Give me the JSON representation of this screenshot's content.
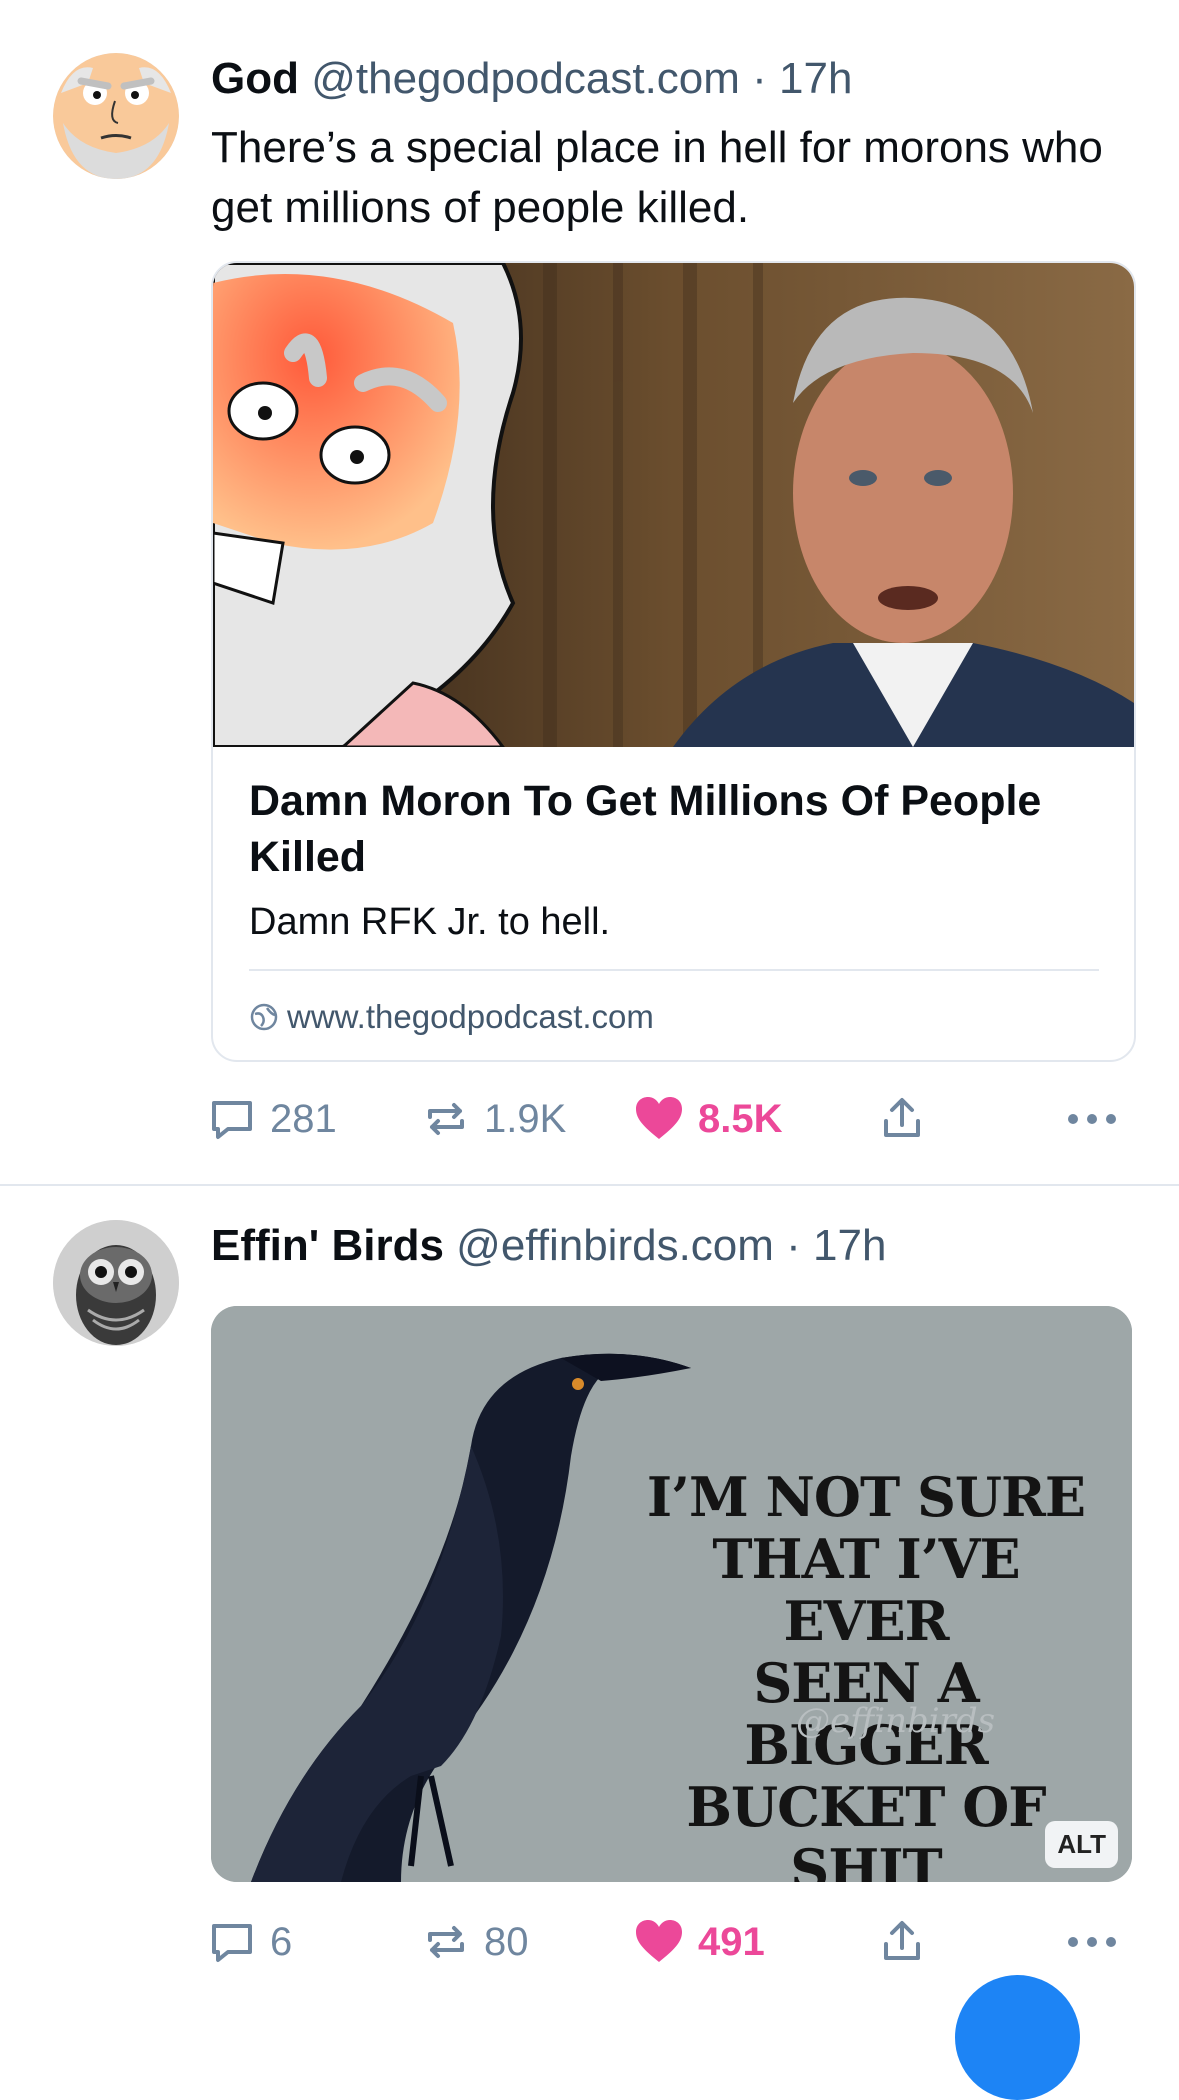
{
  "colors": {
    "text_primary": "#0b0f14",
    "text_secondary": "#42576c",
    "action_gray": "#6f869f",
    "like_pink": "#ec4899",
    "border": "#e2e7ee",
    "fab_blue": "#1d84f5"
  },
  "posts": [
    {
      "author_name": "God",
      "handle": "@thegodpodcast.com",
      "separator": "·",
      "time": "17h",
      "text": "There’s a special place in hell for morons who get millions of people killed.",
      "avatar_icon": "cartoon-god-face-avatar",
      "link_card": {
        "image_icon": "angry-cartoon-god-and-man-photo",
        "title": "Damn Moron To Get Millions Of People Killed",
        "description": "Damn RFK Jr. to hell.",
        "domain": "www.thegodpodcast.com",
        "domain_icon": "globe-icon"
      },
      "actions": {
        "replies": "281",
        "reposts": "1.9K",
        "likes": "8.5K",
        "liked": true
      }
    },
    {
      "author_name": "Effin' Birds",
      "handle": "@effinbirds.com",
      "separator": "·",
      "time": "17h",
      "avatar_icon": "owl-drawing-avatar",
      "image": {
        "image_icon": "black-crow-illustration",
        "caption_lines": [
          "I’M NOT SURE",
          "THAT I’VE EVER",
          "SEEN A BIGGER",
          "BUCKET OF SHIT"
        ],
        "watermark": "@effinbirds",
        "alt_badge": "ALT"
      },
      "actions": {
        "replies": "6",
        "reposts": "80",
        "likes": "491",
        "liked": true
      }
    }
  ]
}
